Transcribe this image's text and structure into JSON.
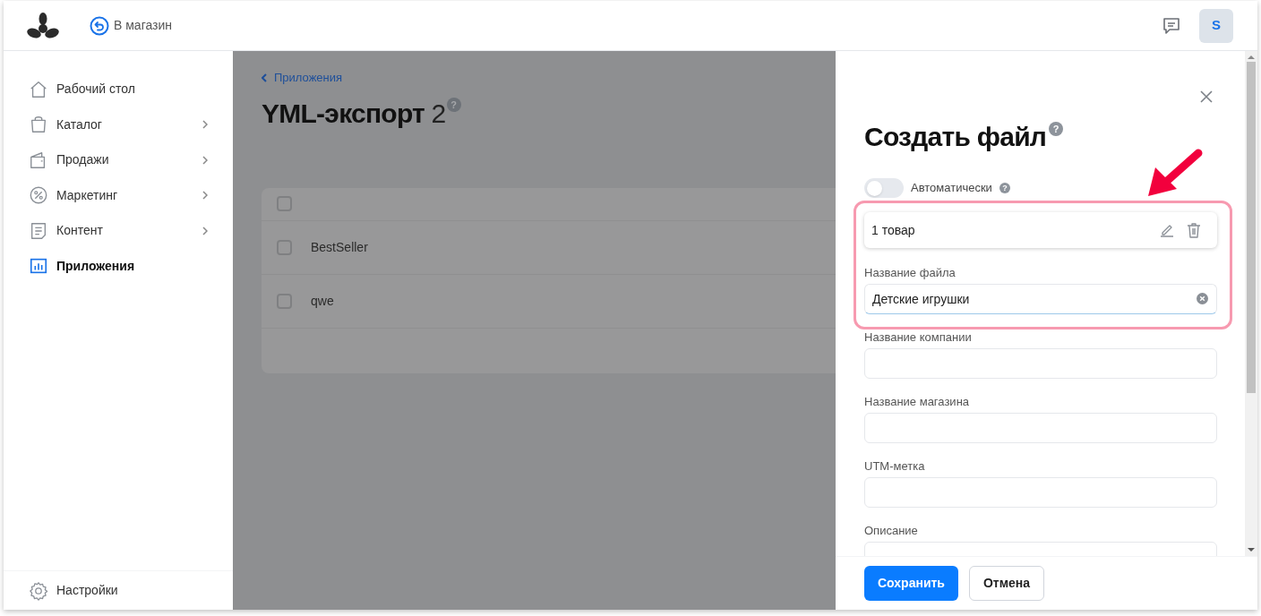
{
  "header": {
    "back_link": "В магазин",
    "avatar": "S"
  },
  "sidebar": {
    "items": [
      {
        "label": "Рабочий стол",
        "kind": "home",
        "has_children": false,
        "selected": false
      },
      {
        "label": "Каталог",
        "kind": "bag",
        "has_children": true,
        "selected": false
      },
      {
        "label": "Продажи",
        "kind": "wallet",
        "has_children": true,
        "selected": false
      },
      {
        "label": "Маркетинг",
        "kind": "percent",
        "has_children": true,
        "selected": false
      },
      {
        "label": "Контент",
        "kind": "doc",
        "has_children": true,
        "selected": false
      },
      {
        "label": "Приложения",
        "kind": "chart",
        "has_children": false,
        "selected": true
      }
    ],
    "footer_item": {
      "label": "Настройки"
    }
  },
  "page": {
    "breadcrumb": "Приложения",
    "title": "YML-экспорт",
    "count": "2",
    "help_icon": "?",
    "table": {
      "header_checked": false,
      "rows": [
        {
          "name": "BestSeller",
          "checked": false
        },
        {
          "name": "qwe",
          "checked": false
        }
      ]
    }
  },
  "drawer": {
    "title": "Создать файл",
    "help_icon": "?",
    "toggle": {
      "label": "Автоматически",
      "on": false,
      "help_icon": "?"
    },
    "fields": [
      {
        "kind": "item",
        "value": "1 товар"
      },
      {
        "kind": "input",
        "label": "Название файла",
        "value": "Детские игрушки",
        "clearable": true
      },
      {
        "kind": "input",
        "label": "Название компании"
      },
      {
        "kind": "input",
        "label": "Название магазина"
      },
      {
        "kind": "input",
        "label": "UTM-метка"
      },
      {
        "kind": "input",
        "label": "Описание"
      }
    ],
    "buttons": [
      {
        "label": "Сохранить",
        "kind": "primary"
      },
      {
        "label": "Отмена",
        "kind": "secondary"
      }
    ]
  }
}
